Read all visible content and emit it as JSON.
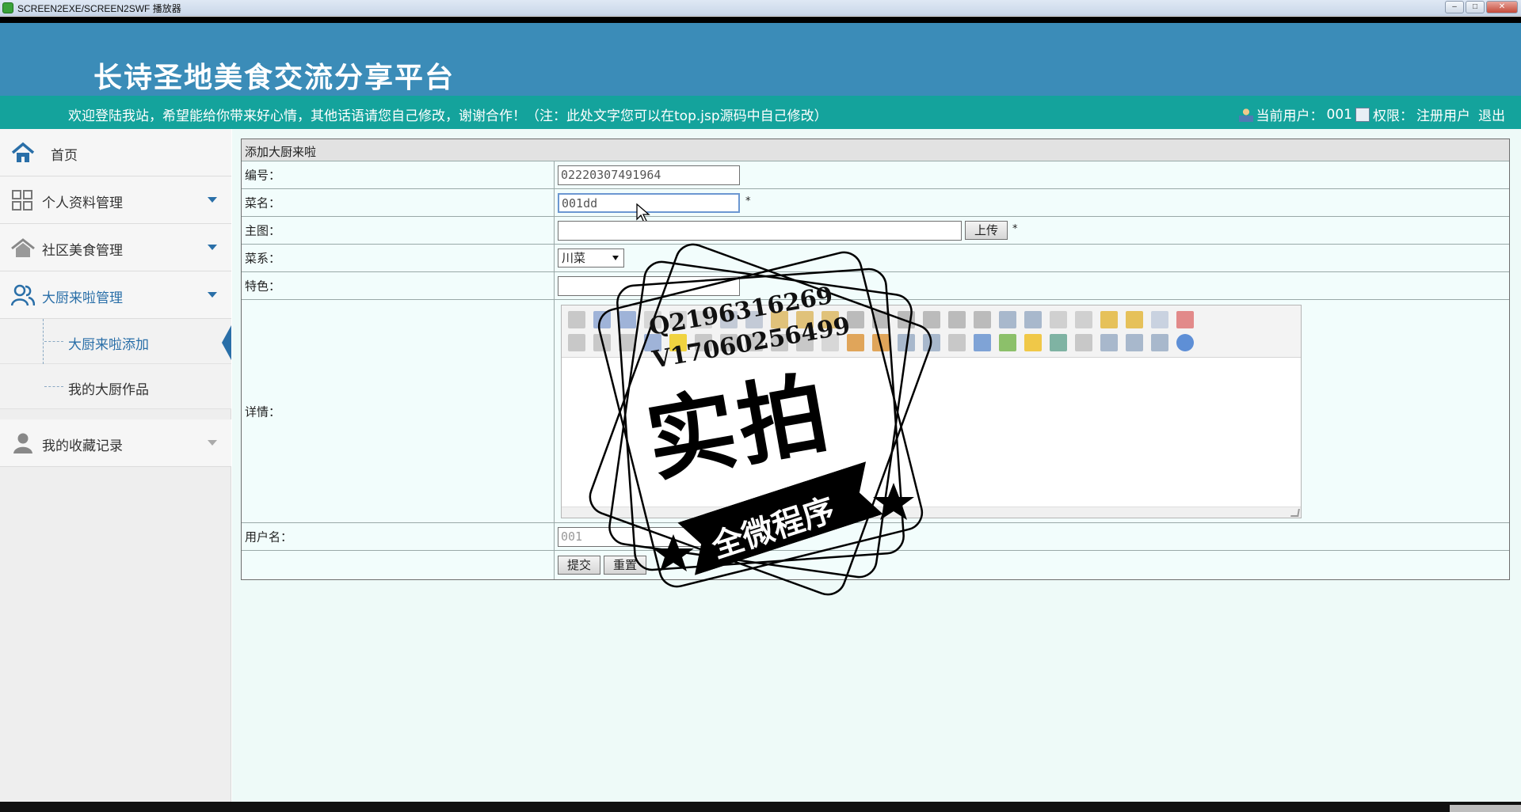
{
  "window": {
    "title": "SCREEN2EXE/SCREEN2SWF 播放器",
    "controls": [
      "–",
      "□",
      "✕"
    ]
  },
  "header": {
    "site_title": "长诗圣地美食交流分享平台",
    "welcome": "欢迎登陆我站，希望能给你带来好心情，其他话语请您自己修改，谢谢合作！（注：此处文字您可以在top.jsp源码中自己修改）",
    "current_user_label": "当前用户：",
    "current_user": "001",
    "permission_label": "权限：",
    "permission": "注册用户",
    "logout": "退出"
  },
  "sidebar": {
    "home": "首页",
    "items": [
      {
        "label": "个人资料管理"
      },
      {
        "label": "社区美食管理"
      },
      {
        "label": "大厨来啦管理",
        "sub": [
          "大厨来啦添加",
          "我的大厨作品"
        ]
      },
      {
        "label": "我的收藏记录"
      }
    ]
  },
  "form": {
    "title": "添加大厨来啦",
    "fields": {
      "number": {
        "label": "编号：",
        "value": "02220307491964"
      },
      "name": {
        "label": "菜名：",
        "value": "001dd",
        "required": "*"
      },
      "image": {
        "label": "主图：",
        "value": "",
        "upload": "上传",
        "required": "*"
      },
      "cuisine": {
        "label": "菜系：",
        "value": "川菜"
      },
      "feature": {
        "label": "特色：",
        "value": ""
      },
      "detail": {
        "label": "详情："
      },
      "username": {
        "label": "用户名：",
        "value": "001"
      }
    },
    "submit": "提交",
    "reset": "重置"
  },
  "watermark": {
    "line1": "Q2196316269",
    "line2": "V17060256499",
    "big": "实拍",
    "ribbon": "全微程序"
  },
  "colors": {
    "header_bg": "#3b8cb8",
    "subbar_bg": "#14a39c",
    "accent": "#2a6fa8",
    "main_bg": "#eefaf8"
  }
}
